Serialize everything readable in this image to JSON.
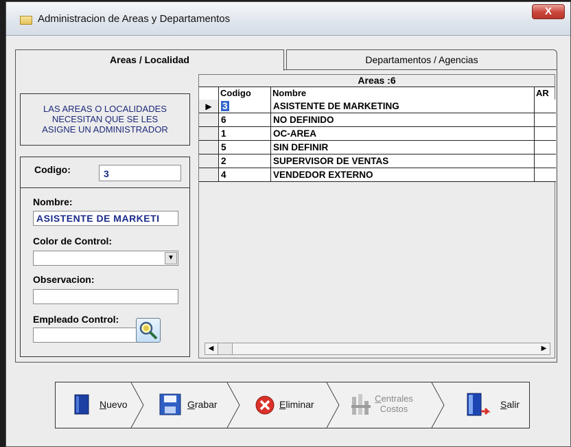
{
  "window": {
    "title": "Administracion de Areas y Departamentos",
    "close_glyph": "X"
  },
  "tabs": [
    {
      "label": "Areas / Localidad",
      "active": true
    },
    {
      "label": "Departamentos / Agencias",
      "active": false
    }
  ],
  "notice": {
    "lines": [
      "LAS AREAS O LOCALIDADES",
      "NECESITAN QUE SE LES",
      "ASIGNE UN ADMINISTRADOR"
    ]
  },
  "form": {
    "codigo_label": "Codigo:",
    "codigo_value": "3",
    "nombre_label": "Nombre:",
    "nombre_value": "ASISTENTE DE MARKETI",
    "color_label": "Color de Control:",
    "color_value": "",
    "observacion_label": "Observacion:",
    "observacion_value": "",
    "empleado_label": "Empleado Control:",
    "empleado_value": ""
  },
  "grid": {
    "caption": "Areas :6",
    "columns": [
      "Codigo",
      "Nombre",
      "AR"
    ],
    "rows": [
      {
        "codigo": "3",
        "nombre": "ASISTENTE DE MARKETING",
        "selected": true
      },
      {
        "codigo": "6",
        "nombre": "NO DEFINIDO"
      },
      {
        "codigo": "1",
        "nombre": "OC-AREA"
      },
      {
        "codigo": "5",
        "nombre": "SIN DEFINIR"
      },
      {
        "codigo": "2",
        "nombre": "SUPERVISOR DE VENTAS"
      },
      {
        "codigo": "4",
        "nombre": "VENDEDOR EXTERNO"
      }
    ]
  },
  "toolbar": {
    "nuevo": {
      "hotkey": "N",
      "rest": "uevo"
    },
    "grabar": {
      "hotkey": "G",
      "rest": "rabar"
    },
    "eliminar": {
      "hotkey": "E",
      "rest": "liminar"
    },
    "centrales": {
      "line1_hotkey": "C",
      "line1_rest": "entrales",
      "line2": "Costos",
      "enabled": false
    },
    "salir": {
      "hotkey": "S",
      "rest": "alir"
    }
  },
  "colors": {
    "accent_text": "#1a2a8a",
    "notice_text": "#1d2a7a"
  }
}
